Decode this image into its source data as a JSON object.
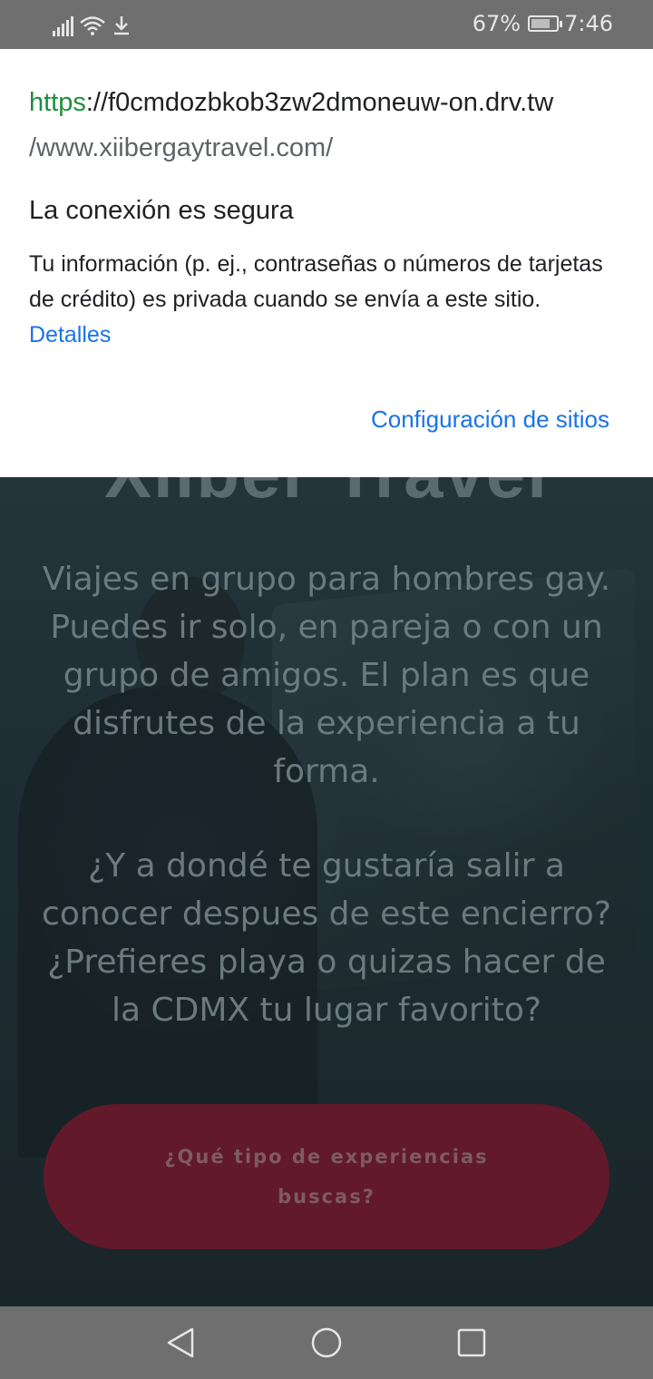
{
  "status_bar": {
    "battery_percent_text": "67%",
    "battery_level": 0.67,
    "time": "7:46",
    "icons": [
      "signal-icon",
      "wifi-icon",
      "download-icon",
      "battery-charging-icon"
    ]
  },
  "popup": {
    "url_scheme": "https",
    "url_rest": "://f0cmdozbkob3zw2dmoneuw-on.drv.tw",
    "url_path": "/www.xiibergaytravel.com/",
    "title": "La conexión es segura",
    "description": "Tu información (p. ej., contraseñas o números de tarjetas de crédito) es privada cuando se envía a este sitio.",
    "details_link": "Detalles",
    "site_settings_link": "Configuración de sitios",
    "colors": {
      "scheme": "#1e8e3e",
      "link": "#1a73e8"
    }
  },
  "page": {
    "title_partial": "Xiiber Travel",
    "paragraph1": "Viajes en grupo para hombres gay. Puedes ir solo, en pareja o con un grupo de amigos. El plan es que disfrutes de la experiencia a tu forma.",
    "paragraph2": "¿Y a dondé te gustaría salir a conocer despues de este encierro? ¿Prefieres playa o quizas hacer de la CDMX tu lugar favorito?",
    "cta_label": "¿Qué tipo de experiencias buscas?",
    "cta_color": "#62192a"
  },
  "nav_bar": {
    "icons": [
      "back-icon",
      "home-icon",
      "recents-icon"
    ]
  }
}
